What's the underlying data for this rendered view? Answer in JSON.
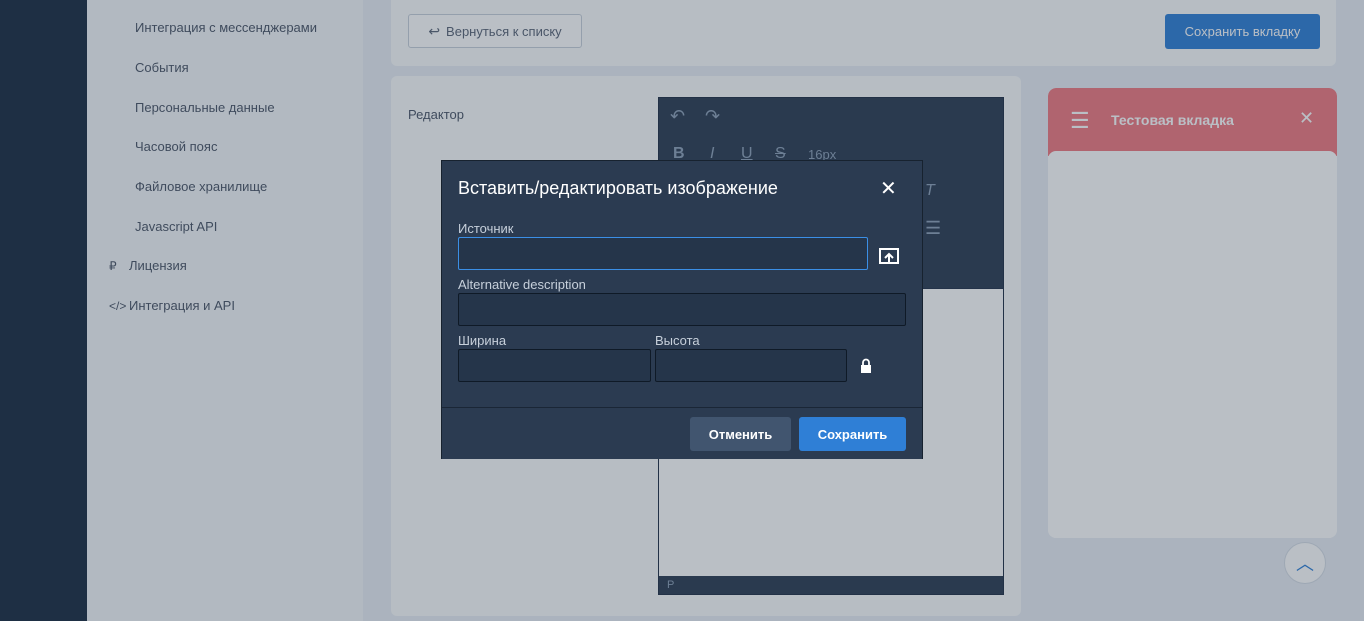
{
  "sidebar": {
    "items": [
      {
        "label": "Интеграция с мессенджерами"
      },
      {
        "label": "События"
      },
      {
        "label": "Персональные данные"
      },
      {
        "label": "Часовой пояс"
      },
      {
        "label": "Файловое хранилище"
      },
      {
        "label": "Javascript API"
      },
      {
        "label": "Лицензия",
        "icon": "ruble-icon"
      },
      {
        "label": "Интеграция и API",
        "icon": "code-icon"
      }
    ]
  },
  "topbar": {
    "back_label": "Вернуться к списку",
    "save_tab_label": "Сохранить вкладку"
  },
  "editor": {
    "label": "Редактор",
    "font_size": "16px",
    "status_path": "P"
  },
  "right_panel": {
    "title": "Тестовая вкладка"
  },
  "modal": {
    "title": "Вставить/редактировать изображение",
    "source_label": "Источник",
    "source_value": "",
    "alt_label": "Alternative description",
    "alt_value": "",
    "width_label": "Ширина",
    "width_value": "",
    "height_label": "Высота",
    "height_value": "",
    "cancel_label": "Отменить",
    "save_label": "Сохранить"
  },
  "colors": {
    "accent": "#2f7fd6",
    "modal_bg": "#2b3b51",
    "tab_header": "#f07a80"
  }
}
